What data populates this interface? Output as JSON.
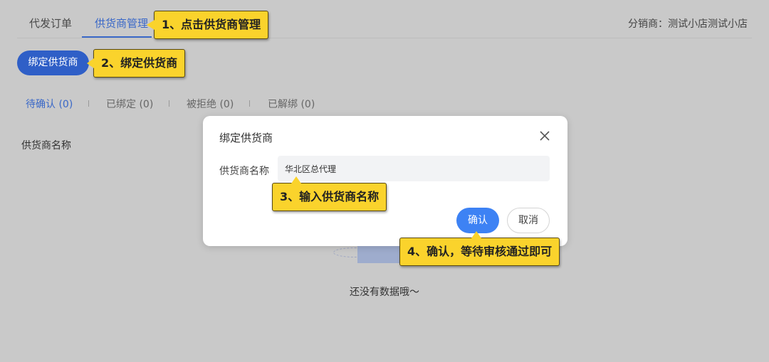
{
  "nav": {
    "tabs": [
      {
        "label": "代发订单",
        "active": false
      },
      {
        "label": "供货商管理",
        "active": true
      }
    ],
    "merchant": "分销商：测试小店测试小店"
  },
  "toolbar": {
    "bind_label": "绑定供货商"
  },
  "sub_tabs": [
    {
      "label": "待确认 (0)",
      "active": true
    },
    {
      "label": "已绑定 (0)",
      "active": false
    },
    {
      "label": "被拒绝 (0)",
      "active": false
    },
    {
      "label": "已解绑 (0)",
      "active": false
    }
  ],
  "table": {
    "header": "供货商名称"
  },
  "empty": {
    "text": "还没有数据哦～"
  },
  "modal": {
    "title": "绑定供货商",
    "field_label": "供货商名称",
    "field_value": "华北区总代理",
    "confirm_label": "确认",
    "cancel_label": "取消"
  },
  "callouts": [
    "1、点击供货商管理",
    "2、绑定供货商",
    "3、输入供货商名称",
    "4、确认，等待审核通过即可"
  ],
  "colors": {
    "accent": "#3a68c8",
    "confirm": "#3d82f4",
    "callout": "#fad32c",
    "overlay": "#c9c9c9"
  },
  "icons": {
    "close": "close-icon"
  }
}
